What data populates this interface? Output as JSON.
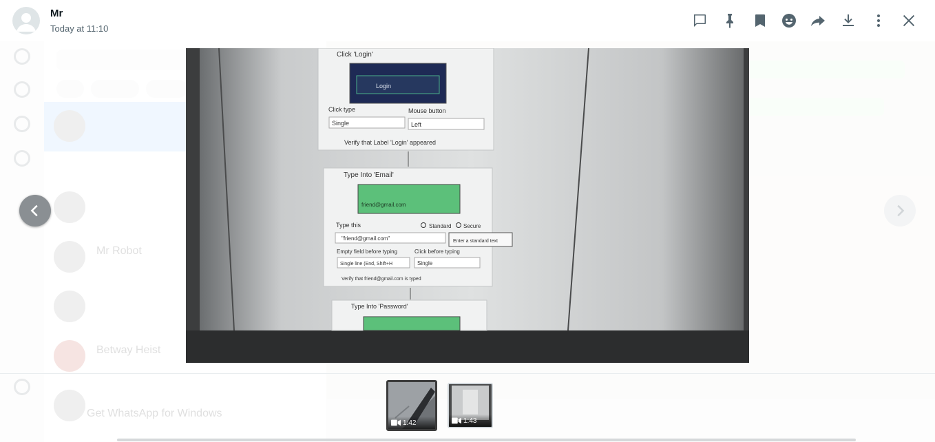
{
  "header": {
    "sender": "Mr",
    "timestamp": "Today at 11:10",
    "icons": [
      "reply-icon",
      "pin-icon",
      "star-icon",
      "react-icon",
      "forward-icon",
      "download-icon",
      "menu-icon",
      "close-icon"
    ]
  },
  "viewer": {
    "content": {
      "card1": {
        "title": "Click 'Login'",
        "button": "Login",
        "click_type_label": "Click type",
        "click_type": "Single",
        "mouse_button_label": "Mouse button",
        "mouse_button": "Left",
        "verify": "Verify that Label 'Login' appeared"
      },
      "card2": {
        "title": "Type Into 'Email'",
        "field_text": "friend@gmail.com",
        "type_this_label": "Type this",
        "standard": "Standard",
        "secure": "Secure",
        "value": "\"friend@gmail.com\"",
        "tooltip": "Enter a standard text",
        "empty_field_label": "Empty field before typing",
        "empty_field": "Single line (End, Shift+H",
        "click_before_label": "Click before typing",
        "click_before": "Single",
        "verify": "Verify that friend@gmail.com is typed"
      },
      "card3": {
        "title": "Type Into 'Password'"
      }
    }
  },
  "thumbnails": [
    {
      "duration": "1:42",
      "selected": true
    },
    {
      "duration": "1:43",
      "selected": false
    }
  ],
  "background": {
    "chats": [
      {
        "name": "",
        "preview": ""
      },
      {
        "name": "",
        "preview": ""
      },
      {
        "name": "Mr Robot",
        "preview": ""
      },
      {
        "name": "",
        "preview": ""
      },
      {
        "name": "Betway Heist",
        "preview": ""
      },
      {
        "name": "",
        "preview": ""
      }
    ],
    "promo": "Get WhatsApp for Windows"
  },
  "colors": {
    "accent": "#00a884",
    "icon": "#54656f",
    "nav_prev": "#8a8f93"
  }
}
